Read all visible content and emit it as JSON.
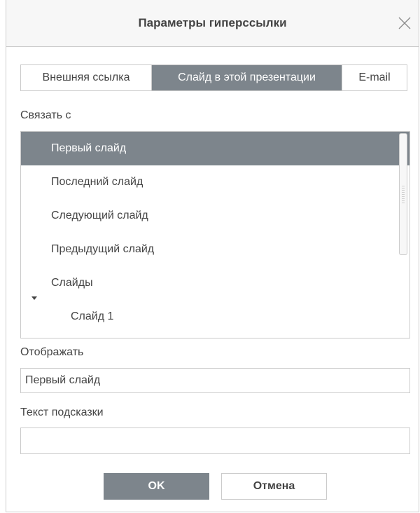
{
  "dialog": {
    "title": "Параметры гиперссылки",
    "close_icon": "close-icon"
  },
  "tabs": [
    {
      "label": "Внешняя ссылка",
      "active": false
    },
    {
      "label": "Слайд в этой презентации",
      "active": true
    },
    {
      "label": "E-mail",
      "active": false
    }
  ],
  "link_to": {
    "label": "Связать с",
    "items": [
      {
        "label": "Первый слайд",
        "selected": true
      },
      {
        "label": "Последний слайд",
        "selected": false
      },
      {
        "label": "Следующий слайд",
        "selected": false
      },
      {
        "label": "Предыдущий слайд",
        "selected": false
      },
      {
        "label": "Слайды",
        "expanded": true,
        "icon": "caret-down-icon"
      },
      {
        "label": "Слайд 1",
        "selected": false
      }
    ]
  },
  "display": {
    "label": "Отображать",
    "value": "Первый слайд"
  },
  "tooltip": {
    "label": "Текст подсказки",
    "value": "",
    "placeholder": ""
  },
  "buttons": {
    "ok": "OK",
    "cancel": "Отмена"
  },
  "colors": {
    "accent": "#7d858c",
    "border": "#cbcbcb",
    "header_bg": "#f7f7f7",
    "text": "#444444"
  }
}
